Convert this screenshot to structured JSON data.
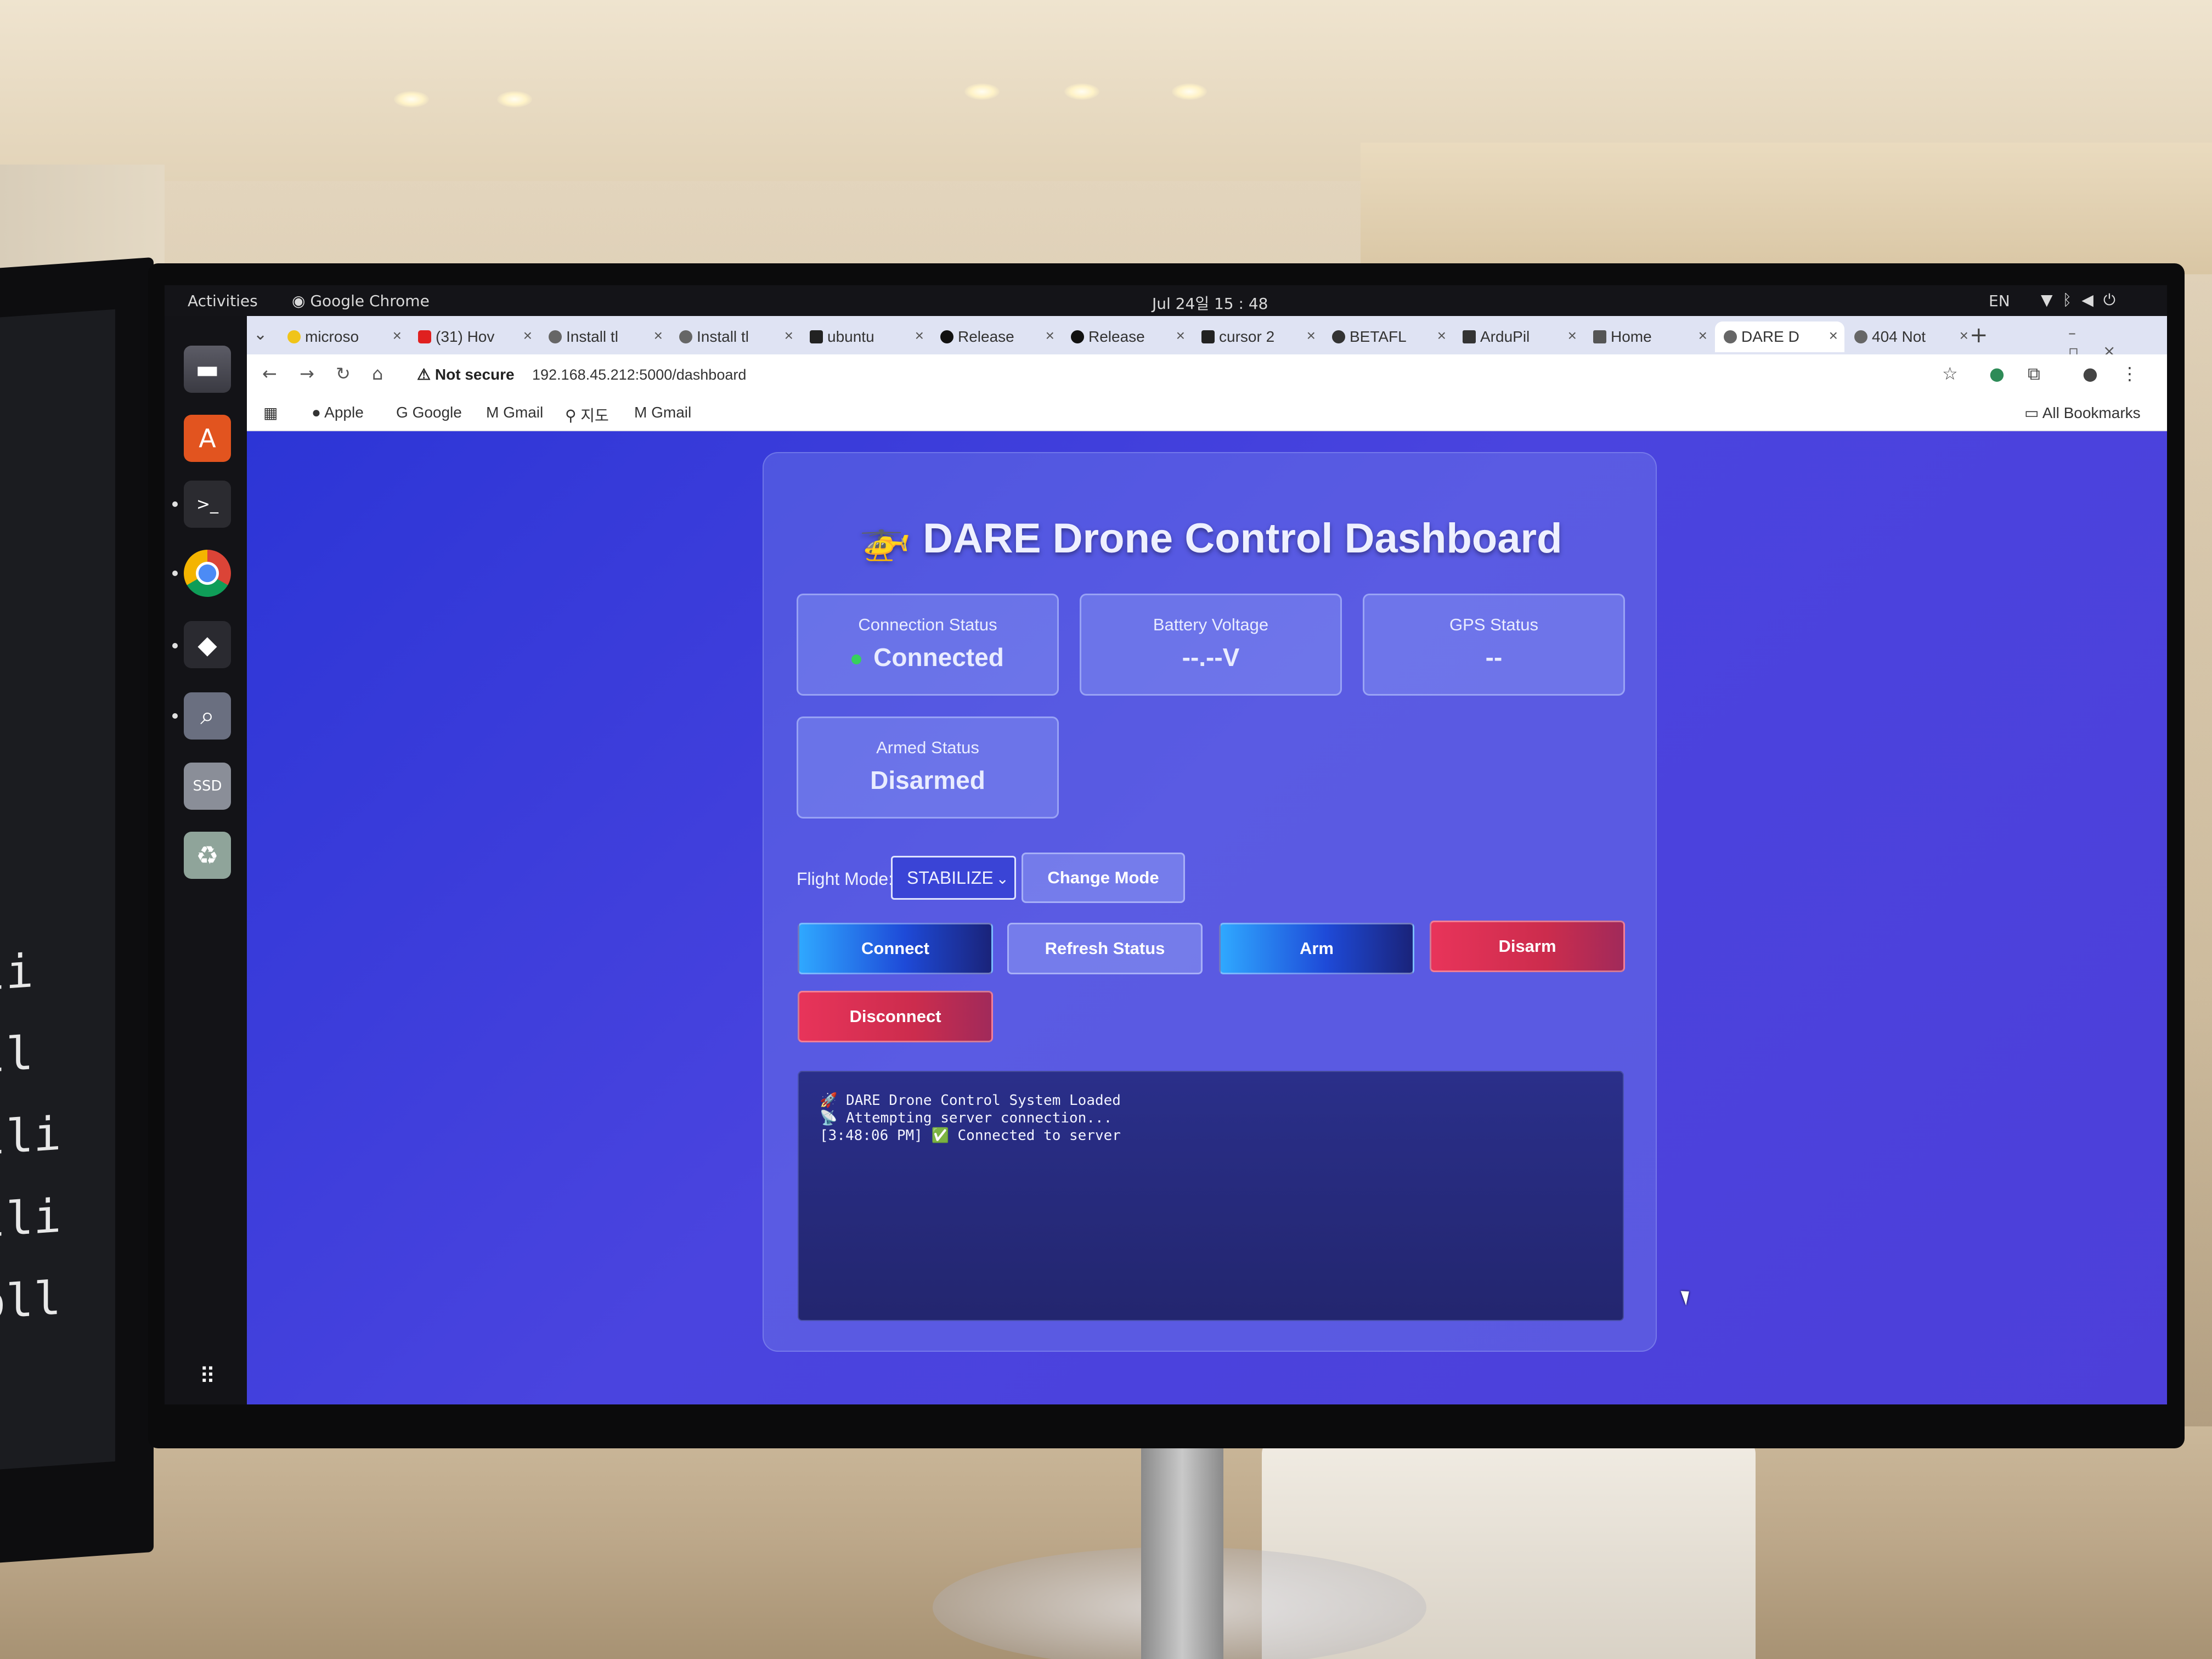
{
  "os_topbar": {
    "activities": "Activities",
    "app_name": "Google Chrome",
    "clock": "Jul 24일 15 : 48",
    "lang": "EN"
  },
  "browser": {
    "tabs": [
      {
        "label": "microso",
        "active": false
      },
      {
        "label": "(31) Hov",
        "active": false
      },
      {
        "label": "Install tl",
        "active": false
      },
      {
        "label": "Install tl",
        "active": false
      },
      {
        "label": "ubuntu",
        "active": false
      },
      {
        "label": "Release",
        "active": false
      },
      {
        "label": "Release",
        "active": false
      },
      {
        "label": "cursor 2",
        "active": false
      },
      {
        "label": "BETAFL",
        "active": false
      },
      {
        "label": "ArduPil",
        "active": false
      },
      {
        "label": "Home",
        "active": false
      },
      {
        "label": "DARE D",
        "active": true
      },
      {
        "label": "404 Not",
        "active": false
      }
    ],
    "security_label": "Not secure",
    "url": "192.168.45.212:5000/dashboard",
    "bookmarks": [
      "Apple",
      "Google",
      "Gmail",
      "지도",
      "Gmail"
    ],
    "all_bookmarks": "All Bookmarks"
  },
  "dashboard": {
    "title": "🚁 DARE Drone Control Dashboard",
    "connection": {
      "label": "Connection Status",
      "value": "Connected",
      "status_color": "#37d05c"
    },
    "battery": {
      "label": "Battery Voltage",
      "value": "--.--V"
    },
    "gps": {
      "label": "GPS Status",
      "value": "--"
    },
    "armed": {
      "label": "Armed Status",
      "value": "Disarmed"
    },
    "flight_mode": {
      "label": "Flight Mode:",
      "selected": "STABILIZE",
      "change_button": "Change Mode"
    },
    "buttons": {
      "connect": "Connect",
      "refresh": "Refresh Status",
      "arm": "Arm",
      "disarm": "Disarm",
      "disconnect": "Disconnect"
    },
    "console_lines": [
      "🚀 DARE Drone Control System Loaded",
      "📡 Attempting server connection...",
      "[3:48:06 PM] ✅ Connected to server"
    ]
  },
  "left_monitor_text": [
    "li",
    "ll",
    "lli",
    "lli",
    "oll"
  ]
}
